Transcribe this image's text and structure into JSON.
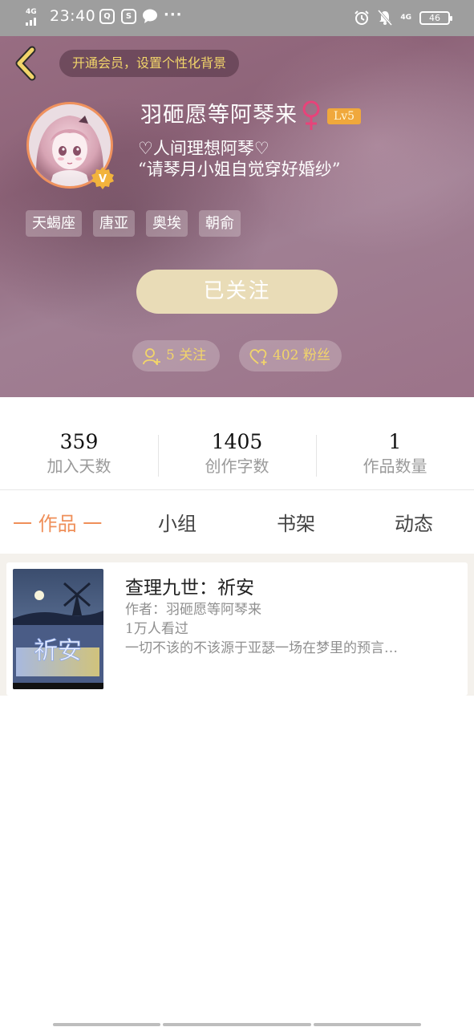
{
  "status_bar": {
    "network": "4G",
    "time": "23:40",
    "app_icons": [
      "qq-icon",
      "sina-icon",
      "chat-bubble-icon"
    ],
    "more": "···",
    "right_network": "4G",
    "battery": "46"
  },
  "header": {
    "vip_prompt": "开通会员，设置个性化背景"
  },
  "profile": {
    "nickname": "羽砸愿等阿琴来",
    "gender_symbol": "♀",
    "level": "Lv5",
    "verified_badge": "V",
    "signature_line1": "♡人间理想阿琴♡",
    "signature_line2": "“请琴月小姐自觉穿好婚纱”",
    "tags": [
      "天蝎座",
      "唐亚",
      "奥埃",
      "朝俞"
    ],
    "follow_button": "已关注",
    "following_label": "5 关注",
    "fans_label": "402 粉丝"
  },
  "stats": [
    {
      "value": "359",
      "label": "加入天数"
    },
    {
      "value": "1405",
      "label": "创作字数"
    },
    {
      "value": "1",
      "label": "作品数量"
    }
  ],
  "tabs": [
    {
      "label": "一 作品 一",
      "active": true
    },
    {
      "label": "小组",
      "active": false
    },
    {
      "label": "书架",
      "active": false
    },
    {
      "label": "动态",
      "active": false
    }
  ],
  "works": [
    {
      "title": "查理九世：祈安",
      "author": "作者：羽砸愿等阿琴来",
      "views": "1万人看过",
      "description": "一切不该的不该源于亚瑟一场在梦里的预言…",
      "cover_text": "祈安"
    }
  ],
  "colors": {
    "accent": "#ef8f59",
    "gold_text": "#f2d56a",
    "follow_button_bg": "#e9dcb7",
    "level_badge": "#f0a83c",
    "gender_pink": "#e7437a"
  }
}
